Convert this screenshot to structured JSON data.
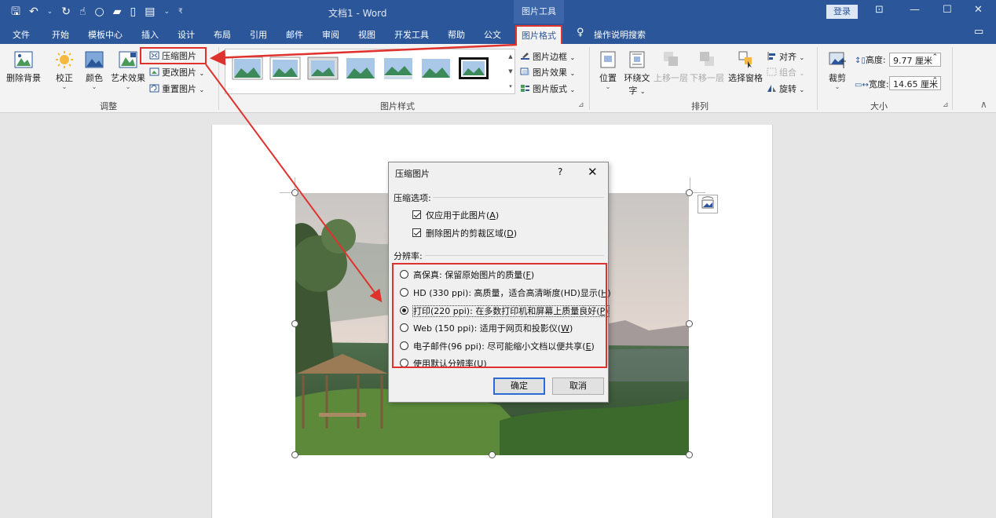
{
  "titlebar": {
    "title": "文档1 - Word",
    "context_tab": "图片工具",
    "login": "登录",
    "qat_icons": [
      "save-icon",
      "undo-icon",
      "redo-icon",
      "touch-mode-icon",
      "circle-icon",
      "open-icon",
      "new-doc-icon",
      "print-preview-icon",
      "customize-icon"
    ]
  },
  "tabs": [
    "文件",
    "开始",
    "模板中心",
    "插入",
    "设计",
    "布局",
    "引用",
    "邮件",
    "审阅",
    "视图",
    "开发工具",
    "帮助",
    "公文",
    "图片格式"
  ],
  "tell_me": "操作说明搜索",
  "ribbon": {
    "adjust": {
      "remove_bg": "删除背景",
      "correct": "校正",
      "color": "颜色",
      "artistic": "艺术效果",
      "compress": "压缩图片",
      "change": "更改图片",
      "reset": "重置图片",
      "label": "调整"
    },
    "styles": {
      "border": "图片边框",
      "effects": "图片效果",
      "layout": "图片版式",
      "label": "图片样式"
    },
    "arrange": {
      "position": "位置",
      "wrap_a": "环绕文",
      "wrap_b": "字",
      "bring_forward": "上移一层",
      "send_backward": "下移一层",
      "selection_pane": "选择窗格",
      "align": "对齐",
      "group": "组合",
      "rotate": "旋转",
      "label": "排列"
    },
    "size": {
      "crop": "裁剪",
      "height_label": "高度:",
      "height_value": "9.77 厘米",
      "width_label": "宽度:",
      "width_value": "14.65 厘米",
      "label": "大小"
    }
  },
  "dialog": {
    "title": "压缩图片",
    "help": "?",
    "close": "✕",
    "options_label": "压缩选项:",
    "opt1": "仅应用于此图片(",
    "opt1_key": "A",
    "opt2": "删除图片的剪裁区域(",
    "opt2_key": "D",
    "resolution_label": "分辨率:",
    "res": [
      {
        "text": "高保真: 保留原始图片的质量(",
        "key": "F"
      },
      {
        "text": "HD (330 ppi): 高质量，适合高清晰度(HD)显示(",
        "key": "H"
      },
      {
        "text": "打印(220 ppi): 在多数打印机和屏幕上质量良好(",
        "key": "P"
      },
      {
        "text": "Web (150 ppi): 适用于网页和投影仪(",
        "key": "W"
      },
      {
        "text": "电子邮件(96 ppi): 尽可能缩小文档以便共享(",
        "key": "E"
      },
      {
        "text": "使用默认分辨率(",
        "key": "U"
      }
    ],
    "selected_resolution": "打印(220 ppi)",
    "close_paren": ")",
    "ok": "确定",
    "cancel": "取消"
  },
  "colors": {
    "word_blue": "#2b579a",
    "highlight_red": "#e0322d"
  }
}
